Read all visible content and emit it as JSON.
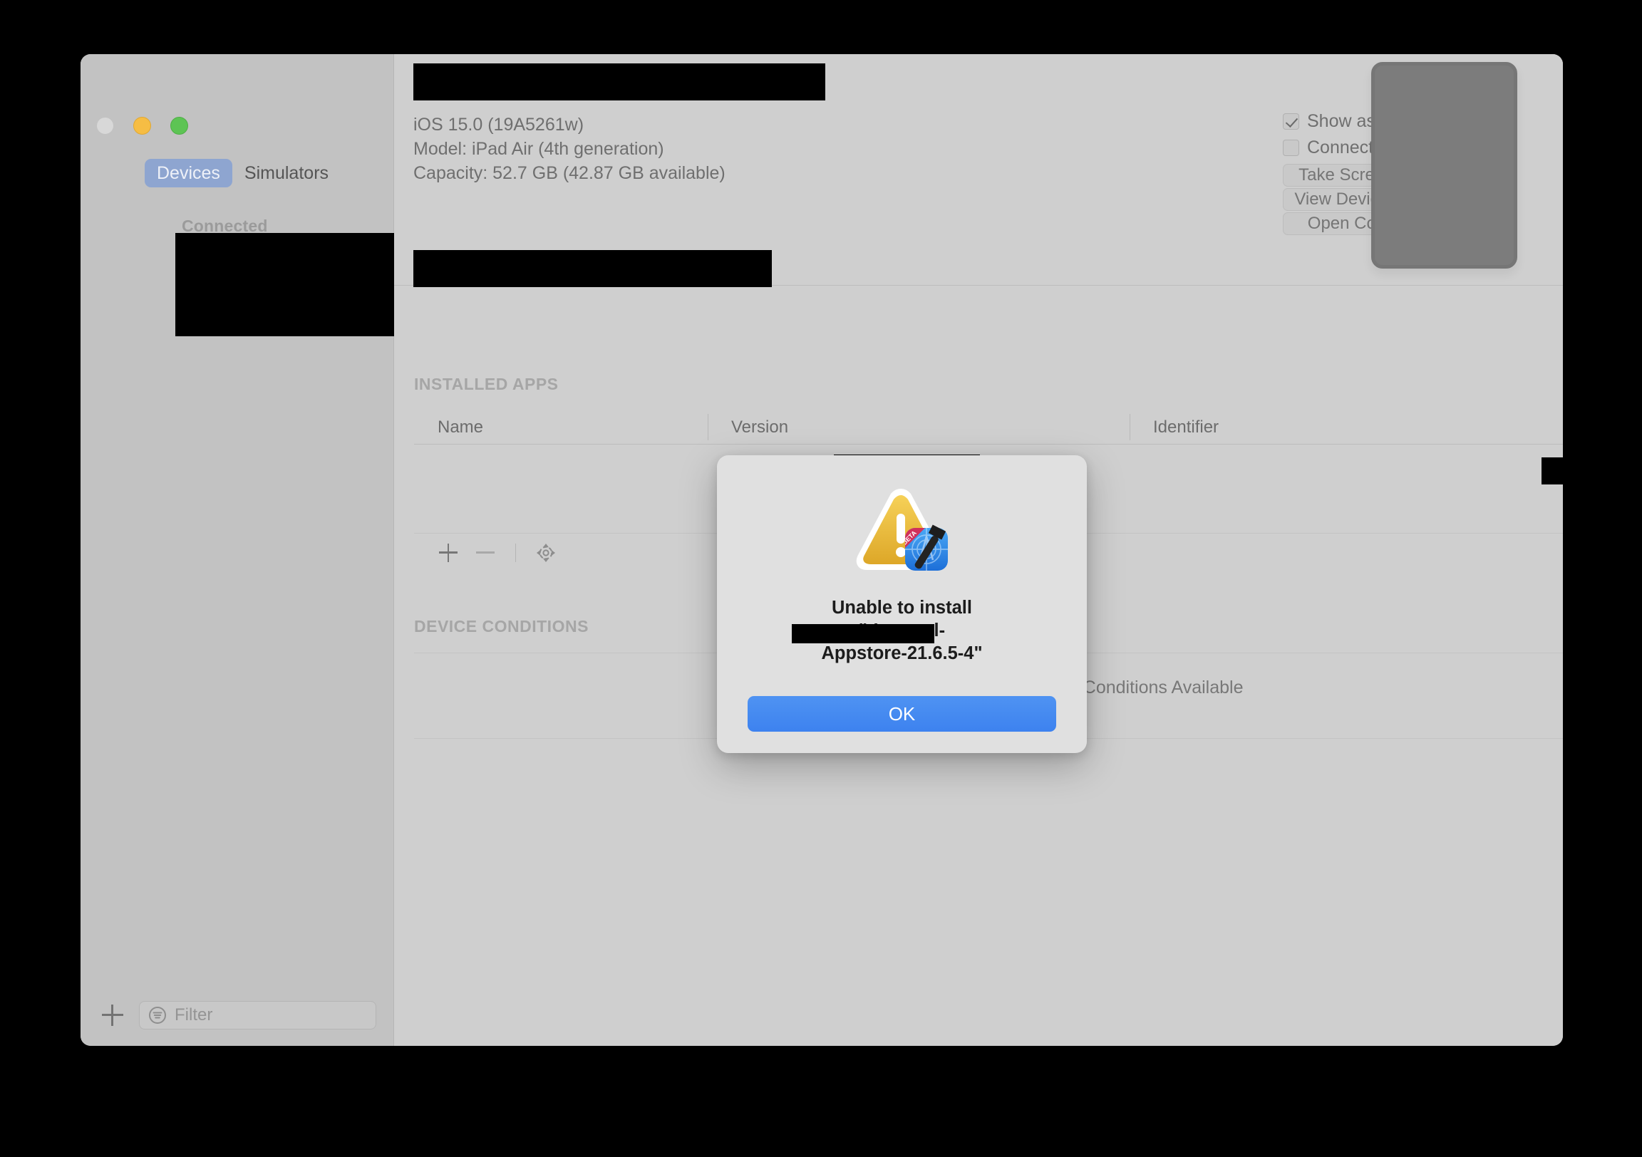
{
  "window": {
    "traffic_lights": [
      "close",
      "minimize",
      "maximize"
    ]
  },
  "sidebar": {
    "segmented_control": {
      "options": [
        {
          "label": "Devices",
          "selected": true
        },
        {
          "label": "Simulators",
          "selected": false
        }
      ]
    },
    "section_header": "Connected",
    "device_list": [
      {
        "label": "",
        "redacted": true,
        "selected": true
      }
    ],
    "footer": {
      "add_button_icon": "plus-icon",
      "filter_icon": "filter-icon",
      "filter_placeholder": "Filter",
      "filter_value": ""
    }
  },
  "device_header": {
    "device_name": "",
    "device_name_redacted": true,
    "meta": [
      "iOS 15.0 (19A5261w)",
      "Model: iPad Air (4th generation)",
      "Capacity: 52.7 GB (42.87 GB available)"
    ],
    "identifier_redacted": true,
    "checkboxes": [
      {
        "label": "Show as run destination",
        "checked": true
      },
      {
        "label": "Connect via network",
        "checked": false
      }
    ],
    "buttons": [
      "Take Screenshot",
      "View Device Logs",
      "Open Console"
    ],
    "device_image_alt": "ipad-silhouette"
  },
  "installed_apps": {
    "section_label": "INSTALLED APPS",
    "columns": [
      "Name",
      "Version",
      "Identifier"
    ],
    "rows": [
      {
        "name": "",
        "version": "",
        "identifier": "",
        "redacted": true
      }
    ],
    "toolbar": {
      "add_icon": "plus-icon",
      "remove_icon": "minus-icon",
      "settings_icon": "gear-icon"
    }
  },
  "device_conditions": {
    "section_label": "DEVICE CONDITIONS",
    "empty_message": "No Device Conditions Available"
  },
  "modal": {
    "icon": "warning-triangle-with-xcode-beta-badge",
    "title_line1": "Unable to install",
    "title_line2_suffix": "-Internal-",
    "title_line3": "Appstore-21.6.5-4\"",
    "title_quote": "\"",
    "app_name_redacted": true,
    "ok_label": "OK"
  },
  "colors": {
    "window_background": "#cfcfcf",
    "sidebar_background": "#c2c2c2",
    "accent_blue": "#3d82ef",
    "segment_selected": "#8ea5d0",
    "warning_yellow": "#f2c33d",
    "modal_background": "#e0e0e0"
  }
}
